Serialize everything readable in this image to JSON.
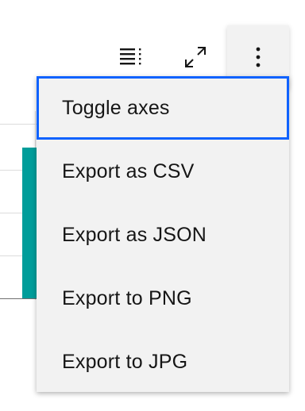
{
  "toolbar": {
    "buttons": [
      {
        "icon": "data-table-icon"
      },
      {
        "icon": "maximize-icon"
      },
      {
        "icon": "overflow-menu-vertical-icon"
      }
    ]
  },
  "menu": {
    "items": [
      {
        "label": "Toggle axes",
        "focused": true
      },
      {
        "label": "Export as CSV"
      },
      {
        "label": "Export as JSON"
      },
      {
        "label": "Export to PNG"
      },
      {
        "label": "Export to JPG"
      }
    ]
  },
  "colors": {
    "bar": "#009d9a",
    "focus": "#0f62fe",
    "menu_background": "#f2f2f2",
    "text": "#161616"
  }
}
